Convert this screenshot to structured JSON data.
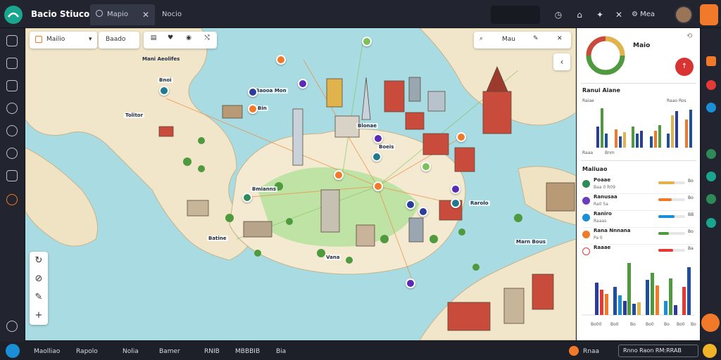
{
  "app": {
    "title": "Bacio Stiuco"
  },
  "tabs": [
    {
      "label": "Mapio",
      "close": "✕"
    },
    {
      "label": "Nocio"
    }
  ],
  "header": {
    "upgrade_label": "Mea"
  },
  "map": {
    "toolbar": {
      "layer_select": "Mailio",
      "view_select": "Baado",
      "right_select": "Mau"
    },
    "labels": [
      "Mani Aeolifes",
      "Bnoi",
      "Baooa Mon",
      "Bin",
      "Tolitor",
      "Blonae",
      "Boeis",
      "Bmianns",
      "Rarolo",
      "Batine",
      "Vana",
      "Marn Bous"
    ],
    "zoom": {
      "in": "+"
    }
  },
  "panel": {
    "header_title": "Maio",
    "section1_title": "Ranui Aiane",
    "section1_sub": "Raiae",
    "section1_sub2": "Raao Ros",
    "chart_labels": [
      "Raaa",
      "Bnm"
    ],
    "section2_title": "Maiiuao",
    "rows": [
      {
        "name": "Poaae",
        "sub": "Baa 0 R09",
        "value": "Bo",
        "color": "#2e8b57",
        "fill": 0.6
      },
      {
        "name": "Ranusaa",
        "sub": "Ra0 5a",
        "value": "Bo",
        "color": "#6a3dbf",
        "fill": 0.5
      },
      {
        "name": "Raniro",
        "sub": "Raaas",
        "value": "BB",
        "color": "#1b8fd6",
        "fill": 0.6
      },
      {
        "name": "Rana Nnnana",
        "sub": "Pa 0",
        "value": "Bo",
        "color": "#f07a2a",
        "fill": 0.4
      },
      {
        "name": "Raaae",
        "sub": "",
        "value": "Ba",
        "color": "#e53935",
        "fill": 0.55
      }
    ],
    "chart_footer": [
      "Bo00",
      "Bo0",
      "Bo",
      "Bo0",
      "Bo",
      "Bo0",
      "Bo"
    ]
  },
  "statusbar": {
    "items": [
      "Maolliao",
      "Rapolo",
      "Nolia",
      "Bamer",
      "RNIB",
      "MBBBIB",
      "Bia"
    ],
    "right_label": "Rnaa",
    "status": "Rnno Raon   RM:RRAB"
  }
}
